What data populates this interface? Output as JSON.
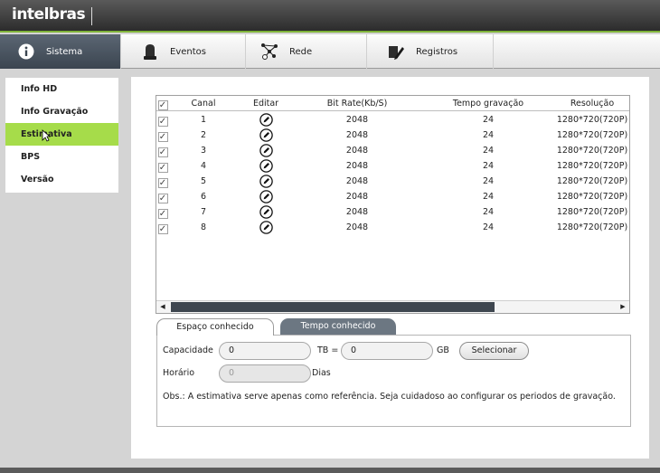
{
  "brand": {
    "logo_text": "intelbras"
  },
  "nav": {
    "items": [
      {
        "label": "Sistema",
        "icon": "info-icon"
      },
      {
        "label": "Eventos",
        "icon": "alarm-icon"
      },
      {
        "label": "Rede",
        "icon": "network-icon"
      },
      {
        "label": "Registros",
        "icon": "pencil-document-icon"
      }
    ]
  },
  "sidebar": {
    "items": [
      {
        "label": "Info HD"
      },
      {
        "label": "Info Gravação"
      },
      {
        "label": "Estimativa"
      },
      {
        "label": "BPS"
      },
      {
        "label": "Versão"
      }
    ],
    "selected_index": 2
  },
  "table": {
    "headers": {
      "check": "✓",
      "channel": "Canal",
      "edit": "Editar",
      "bitrate": "Bit Rate(Kb/S)",
      "rec_time": "Tempo gravação",
      "resolution": "Resolução"
    },
    "rows": [
      {
        "channel": "1",
        "bitrate": "2048",
        "rec_time": "24",
        "resolution": "1280*720(720P)"
      },
      {
        "channel": "2",
        "bitrate": "2048",
        "rec_time": "24",
        "resolution": "1280*720(720P)"
      },
      {
        "channel": "3",
        "bitrate": "2048",
        "rec_time": "24",
        "resolution": "1280*720(720P)"
      },
      {
        "channel": "4",
        "bitrate": "2048",
        "rec_time": "24",
        "resolution": "1280*720(720P)"
      },
      {
        "channel": "5",
        "bitrate": "2048",
        "rec_time": "24",
        "resolution": "1280*720(720P)"
      },
      {
        "channel": "6",
        "bitrate": "2048",
        "rec_time": "24",
        "resolution": "1280*720(720P)"
      },
      {
        "channel": "7",
        "bitrate": "2048",
        "rec_time": "24",
        "resolution": "1280*720(720P)"
      },
      {
        "channel": "8",
        "bitrate": "2048",
        "rec_time": "24",
        "resolution": "1280*720(720P)"
      }
    ],
    "check_mark": "✓"
  },
  "tabs": {
    "known_space": "Espaço conhecido",
    "known_time": "Tempo conhecido"
  },
  "form": {
    "capacity_label": "Capacidade",
    "capacity_value": "0",
    "tb_label": "TB =",
    "gb_value": "0",
    "gb_label": "GB",
    "select_button": "Selecionar",
    "time_label": "Horário",
    "time_value": "0",
    "days_label": "Dias",
    "note": "Obs.: A estimativa serve apenas como referência. Seja cuidadoso ao configurar os periodos de gravação."
  },
  "colors": {
    "accent_green": "#a6dc4a",
    "nav_active": "#4a5561",
    "scroll_thumb": "#3e464f"
  }
}
